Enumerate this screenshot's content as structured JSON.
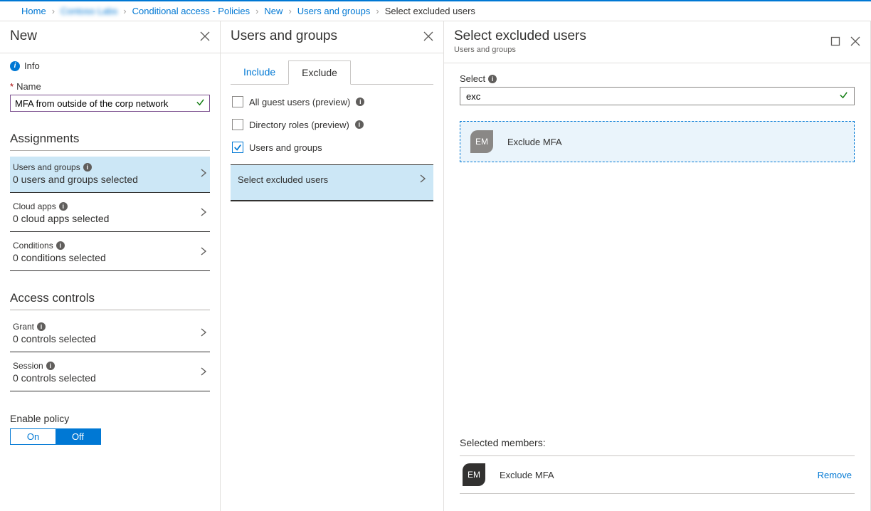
{
  "breadcrumb": {
    "home": "Home",
    "org": "Contoso Labs",
    "ca": "Conditional access - Policies",
    "new": "New",
    "ug": "Users and groups",
    "current": "Select excluded users"
  },
  "col1": {
    "title": "New",
    "info": "Info",
    "name_label": "Name",
    "name_value": "MFA from outside of the corp network",
    "section_assignments": "Assignments",
    "item_users": {
      "top": "Users and groups",
      "bot": "0 users and groups selected"
    },
    "item_apps": {
      "top": "Cloud apps",
      "bot": "0 cloud apps selected"
    },
    "item_cond": {
      "top": "Conditions",
      "bot": "0 conditions selected"
    },
    "section_access": "Access controls",
    "item_grant": {
      "top": "Grant",
      "bot": "0 controls selected"
    },
    "item_session": {
      "top": "Session",
      "bot": "0 controls selected"
    },
    "enable_label": "Enable policy",
    "toggle_on": "On",
    "toggle_off": "Off"
  },
  "col2": {
    "title": "Users and groups",
    "tab_include": "Include",
    "tab_exclude": "Exclude",
    "opt_guests": "All guest users (preview)",
    "opt_roles": "Directory roles (preview)",
    "opt_users": "Users and groups",
    "select_bar": "Select excluded users"
  },
  "col3": {
    "title": "Select excluded users",
    "subtitle": "Users and groups",
    "select_label": "Select",
    "search_value": "exc",
    "result": {
      "initials": "EM",
      "name": "Exclude MFA"
    },
    "selected_title": "Selected members:",
    "selected": {
      "initials": "EM",
      "name": "Exclude MFA"
    },
    "remove": "Remove"
  }
}
